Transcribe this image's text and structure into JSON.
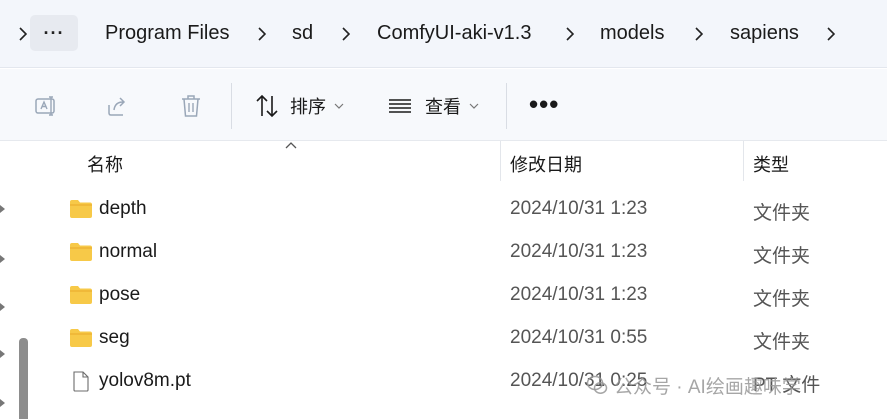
{
  "address_bar": {
    "more_label": "···",
    "crumbs": [
      "Program Files",
      "sd",
      "ComfyUI-aki-v1.3",
      "models",
      "sapiens"
    ]
  },
  "command_bar": {
    "sort_label": "排序",
    "view_label": "查看",
    "more_label": "•••"
  },
  "columns": {
    "name": "名称",
    "date_modified": "修改日期",
    "type": "类型"
  },
  "files": [
    {
      "name": "depth",
      "date": "2024/10/31 1:23",
      "type": "文件夹",
      "icon": "folder-icon"
    },
    {
      "name": "normal",
      "date": "2024/10/31 1:23",
      "type": "文件夹",
      "icon": "folder-icon"
    },
    {
      "name": "pose",
      "date": "2024/10/31 1:23",
      "type": "文件夹",
      "icon": "folder-icon"
    },
    {
      "name": "seg",
      "date": "2024/10/31 0:55",
      "type": "文件夹",
      "icon": "folder-icon"
    },
    {
      "name": "yolov8m.pt",
      "date": "2024/10/31 0:25",
      "type": "PT 文件",
      "icon": "file-icon"
    }
  ],
  "watermark": {
    "text": "公众号 · AI绘画趣味学"
  },
  "colors": {
    "folder": "#f7c948",
    "folder_dark": "#e8a92a",
    "accent": "#0067c0"
  }
}
